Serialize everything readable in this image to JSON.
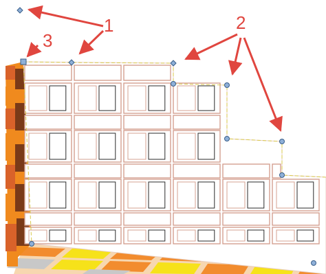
{
  "annotations": {
    "label_1": "1",
    "label_2": "2",
    "label_3": "3"
  },
  "colors": {
    "callout": "#e0463f",
    "handle_fill": "#8fb0d8",
    "handle_stroke": "#3a5f8a",
    "guide": "#d8c84a",
    "block_outline": "#d4a090",
    "block_inner": "#2a2a2a",
    "side_wall_orange": "#f08a1e",
    "side_wall_dark": "#7a3a18",
    "floor_orange": "#f28c2e",
    "floor_yellow": "#f6e21a",
    "floor_grey": "#c8c8c8"
  }
}
